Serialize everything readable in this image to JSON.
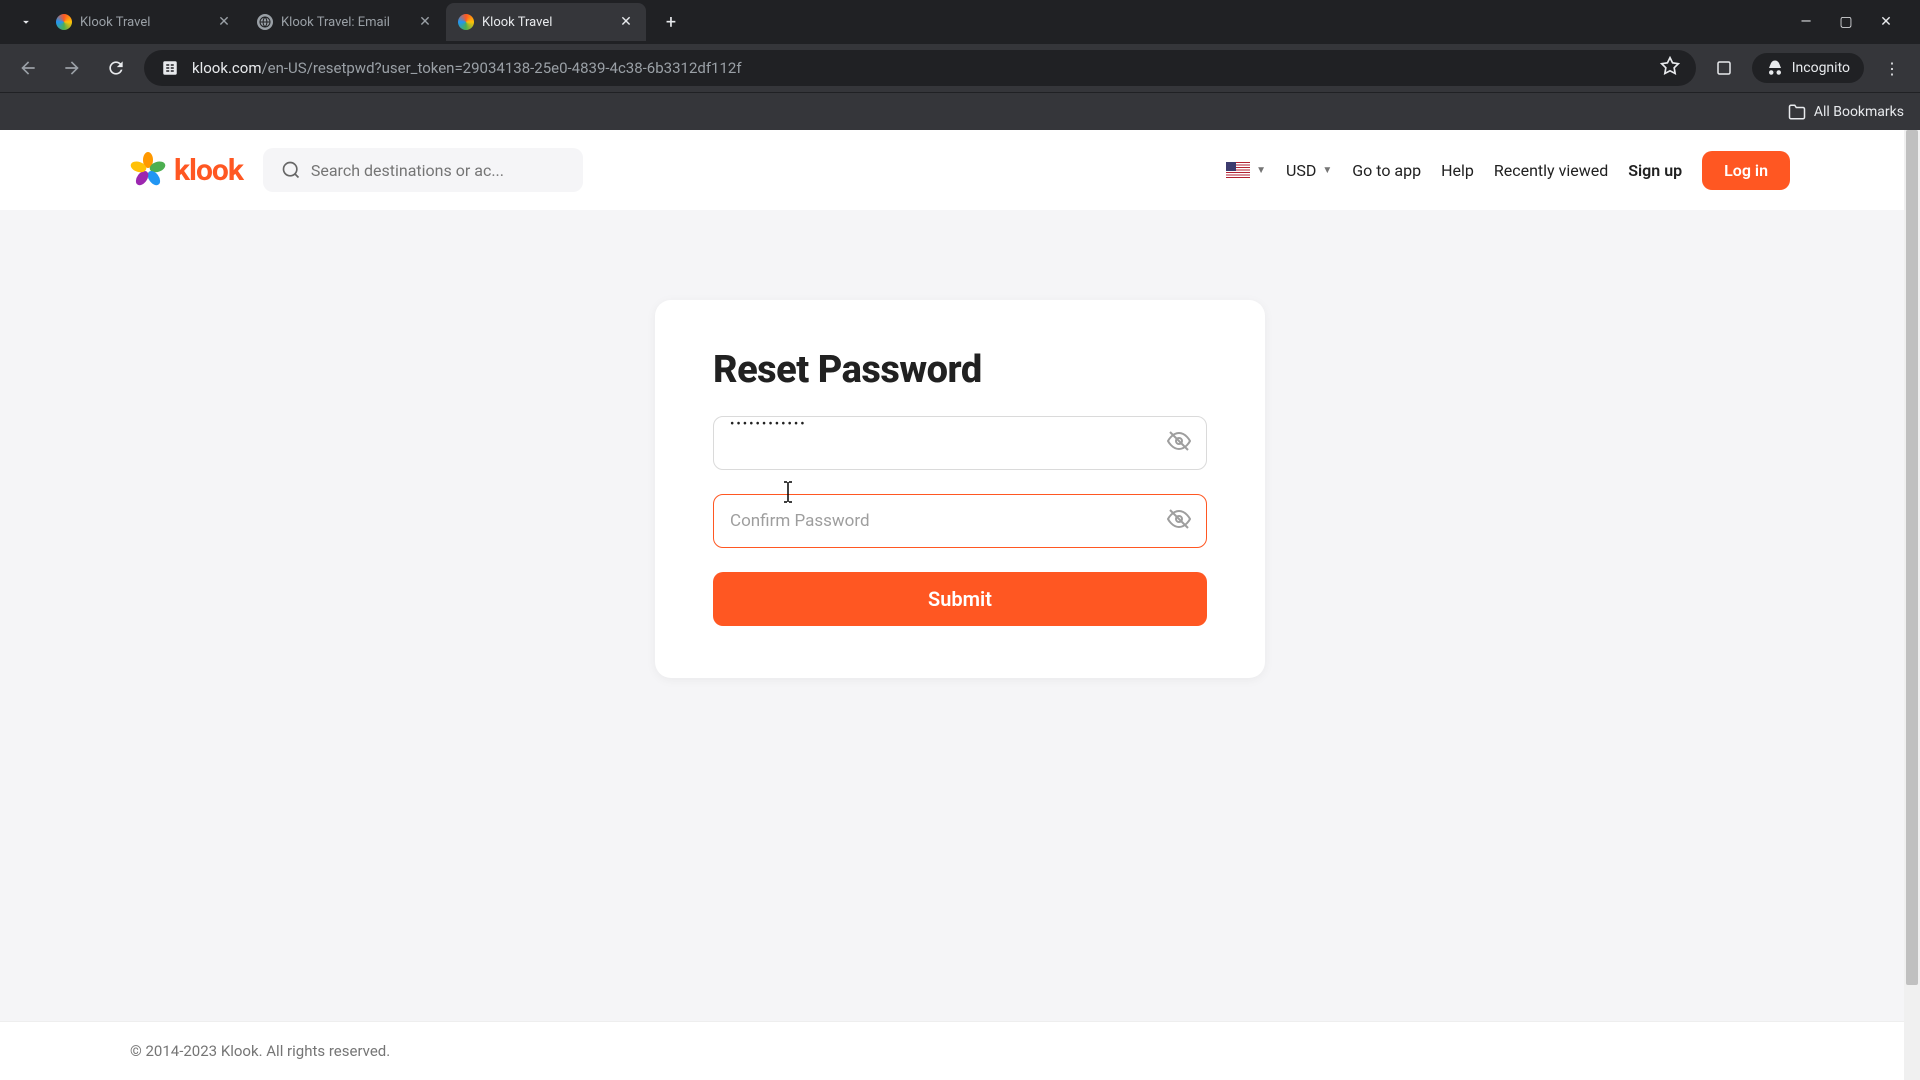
{
  "browser": {
    "tabs": [
      {
        "title": "Klook Travel",
        "active": false,
        "favicon": "klook"
      },
      {
        "title": "Klook Travel: Email",
        "active": false,
        "favicon": "globe"
      },
      {
        "title": "Klook Travel",
        "active": true,
        "favicon": "klook"
      }
    ],
    "url_domain": "klook.com",
    "url_path": "/en-US/resetpwd?user_token=29034138-25e0-4839-4c38-6b3312df112f",
    "incognito_label": "Incognito",
    "all_bookmarks_label": "All Bookmarks"
  },
  "header": {
    "logo_text": "klook",
    "search_placeholder": "Search destinations or ac...",
    "currency": "USD",
    "nav": {
      "go_to_app": "Go to app",
      "help": "Help",
      "recently_viewed": "Recently viewed",
      "sign_up": "Sign up",
      "log_in": "Log in"
    }
  },
  "form": {
    "title": "Reset Password",
    "password_value": "••••••••••••",
    "confirm_placeholder": "Confirm Password",
    "submit_label": "Submit"
  },
  "footer": {
    "copyright": "© 2014-2023 Klook. All rights reserved."
  }
}
